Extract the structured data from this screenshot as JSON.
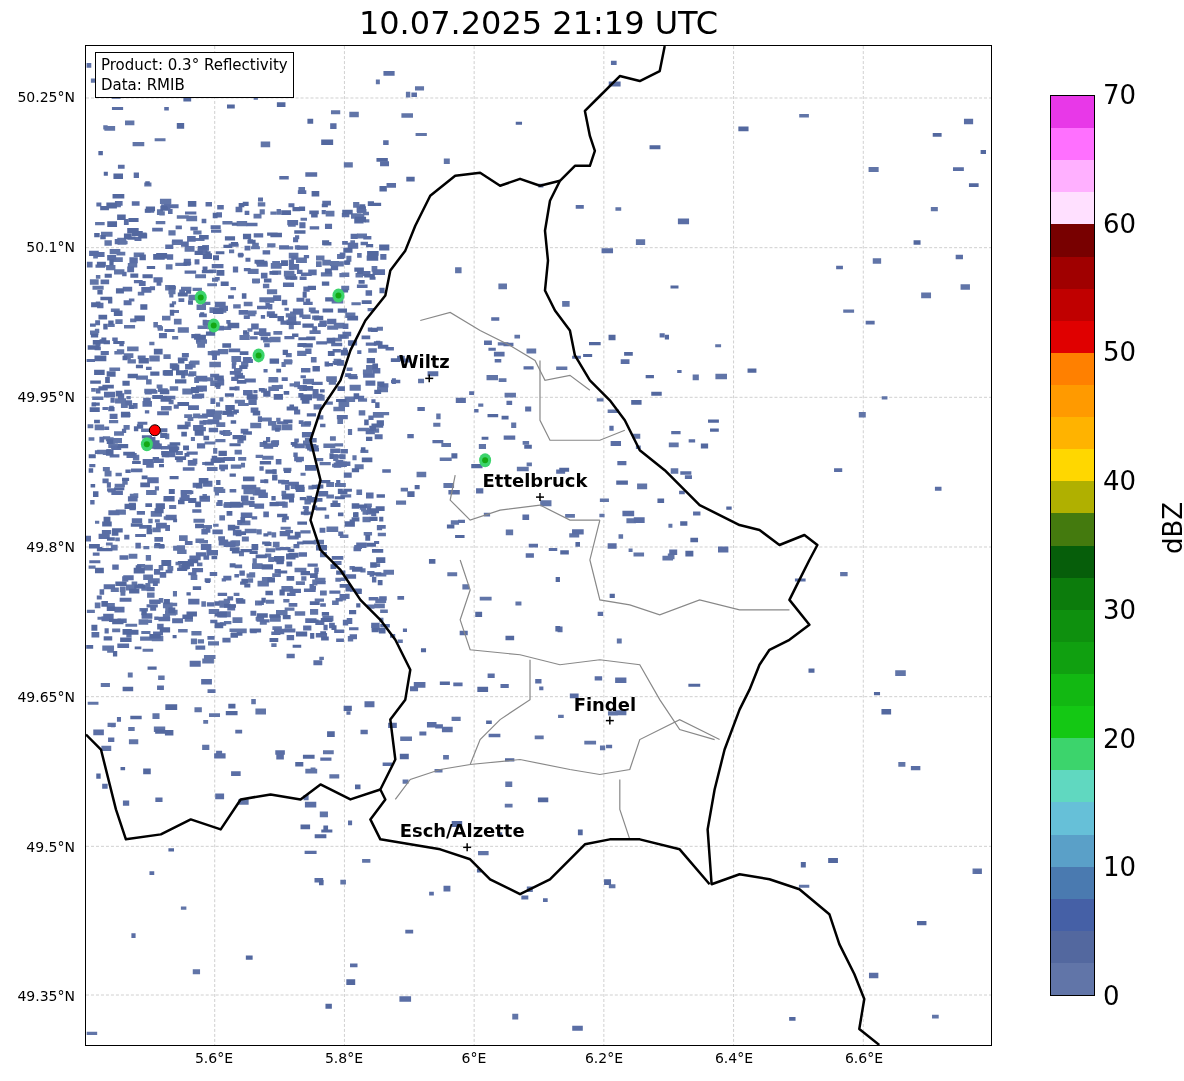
{
  "title": "10.07.2025 21:19 UTC",
  "map": {
    "info_box": [
      "Product: 0.3° Reflectivity",
      "Data: RMIB"
    ],
    "cities": [
      {
        "name": "Wiltz"
      },
      {
        "name": "Ettelbruck"
      },
      {
        "name": "Findel"
      },
      {
        "name": "Esch/Alzette"
      }
    ],
    "y_ticks": [
      "50.25°N",
      "50.1°N",
      "49.95°N",
      "49.8°N",
      "49.65°N",
      "49.5°N",
      "49.35°N"
    ],
    "x_ticks": [
      "5.6°E",
      "5.8°E",
      "6°E",
      "6.2°E",
      "6.4°E",
      "6.6°E"
    ]
  },
  "colorbar": {
    "label": "dBZ",
    "ticks": [
      "70",
      "60",
      "50",
      "40",
      "30",
      "20",
      "10",
      "0"
    ],
    "bins": [
      {
        "color": "#e838e8"
      },
      {
        "color": "#ff70ff"
      },
      {
        "color": "#ffb0ff"
      },
      {
        "color": "#ffe0ff"
      },
      {
        "color": "#780000"
      },
      {
        "color": "#a00000"
      },
      {
        "color": "#c00000"
      },
      {
        "color": "#e00000"
      },
      {
        "color": "#ff8000"
      },
      {
        "color": "#ff9a00"
      },
      {
        "color": "#ffb300"
      },
      {
        "color": "#ffd700"
      },
      {
        "color": "#b0b000"
      },
      {
        "color": "#447a0e"
      },
      {
        "color": "#065e0a"
      },
      {
        "color": "#0c7c0c"
      },
      {
        "color": "#0e900e"
      },
      {
        "color": "#10a010"
      },
      {
        "color": "#12b812"
      },
      {
        "color": "#14c814"
      },
      {
        "color": "#3cd46c"
      },
      {
        "color": "#60d8c0"
      },
      {
        "color": "#66c0d8"
      },
      {
        "color": "#5aa0c8"
      },
      {
        "color": "#4a7ab0"
      },
      {
        "color": "#4560a6"
      },
      {
        "color": "#53689f"
      },
      {
        "color": "#6175a8"
      }
    ]
  }
}
